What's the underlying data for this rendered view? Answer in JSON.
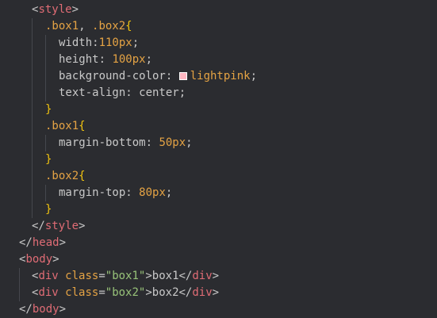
{
  "colors": {
    "background": "#2b2c30",
    "tag": "#e06c75",
    "selector": "#e5a344",
    "brace": "#f1c40f",
    "string": "#98c379",
    "text": "#c9c9c9",
    "swatch": "#ffb6c1"
  },
  "code": {
    "style_open": "style",
    "box_selector_a": ".box1",
    "box_selector_sep": ", ",
    "box_selector_b": ".box2",
    "width_prop": "width:",
    "width_val": "110px",
    "height_prop": "height: ",
    "height_val": "100px",
    "bg_prop": "background-color: ",
    "bg_val": "lightpink",
    "align_prop": "text-align: center;",
    "box1_selector": ".box1",
    "mb_prop": "margin-bottom: ",
    "mb_val": "50px",
    "box2_selector": ".box2",
    "mt_prop": "margin-top: ",
    "mt_val": "80px",
    "style_close": "style",
    "head_close": "head",
    "body_open": "body",
    "div_tag": "div",
    "class_attr": "class",
    "box1_class": "\"box1\"",
    "box1_text": "box1",
    "box2_class": "\"box2\"",
    "box2_text": "box2",
    "body_close": "body"
  }
}
